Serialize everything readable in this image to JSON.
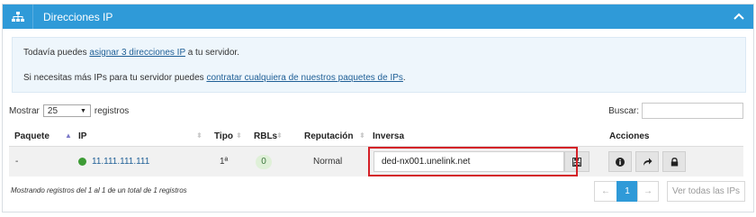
{
  "panel": {
    "title": "Direcciones IP",
    "header_color": "#2f9ad8"
  },
  "notice": {
    "line1_prefix": "Todavía puedes ",
    "line1_link": "asignar 3 direcciones IP",
    "line1_suffix": " a tu servidor.",
    "line2_prefix": "Si necesitas más IPs para tu servidor puedes ",
    "line2_link": "contratar cualquiera de nuestros paquetes de IPs",
    "line2_suffix": "."
  },
  "table_controls": {
    "show_label": "Mostrar",
    "page_length": "25",
    "records_label": "registros",
    "search_label": "Buscar:",
    "search_value": ""
  },
  "columns": [
    "Paquete",
    "IP",
    "Tipo",
    "RBLs",
    "Reputación",
    "Inversa",
    "Acciones"
  ],
  "rows": [
    {
      "paquete": "-",
      "ip": "11.111.111.111",
      "status_color": "#3d9b35",
      "tipo": "1ª",
      "rbls": "0",
      "reputacion": "Normal",
      "inversa": "ded-nx001.unelink.net"
    }
  ],
  "footer": {
    "info": "Mostrando registros del 1 al 1 de un total de 1 registros",
    "prev": "←",
    "current_page": "1",
    "next": "→",
    "view_all": "Ver todas las IPs"
  },
  "icons": {
    "header": "sitemap-icon",
    "collapse": "chevron-up-icon",
    "save": "save-icon",
    "info": "info-icon",
    "redirect": "share-icon",
    "lock": "lock-icon"
  },
  "highlight_color": "#d42027"
}
